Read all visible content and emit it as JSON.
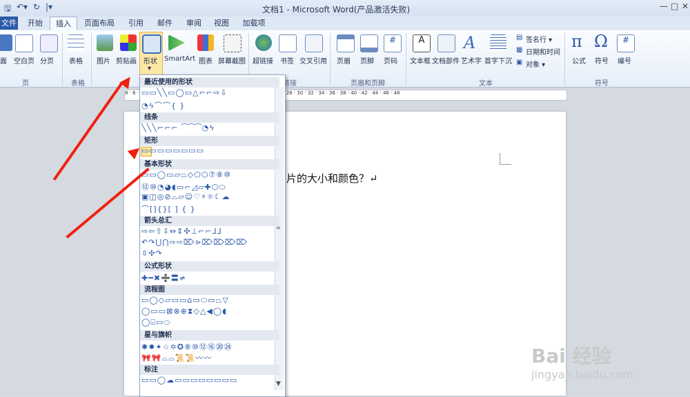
{
  "window": {
    "title": "文档1 - Microsoft Word(产品激活失败)",
    "controls": [
      "—",
      "□",
      "✕"
    ]
  },
  "tabs": [
    "文件",
    "开始",
    "插入",
    "页面布局",
    "引用",
    "邮件",
    "审阅",
    "视图",
    "加载项"
  ],
  "ribbon": {
    "buttons": {
      "cover": "面",
      "blank": "空白页",
      "break": "分页",
      "table": "表格",
      "picture": "图片",
      "clipart": "剪贴画",
      "shapes": "形状",
      "smartart": "SmartArt",
      "chart": "图表",
      "screenshot": "屏幕截图",
      "hyperlink": "超链接",
      "bookmark": "书签",
      "crossref": "交叉引用",
      "header": "页眉",
      "footer": "页脚",
      "pagenum": "页码",
      "textbox": "文本框",
      "quickparts": "文档部件",
      "wordart": "艺术字",
      "dropcap": "首字下沉",
      "signature": "签名行 ▾",
      "datetime": "日期和时间",
      "object": "对象 ▾",
      "equation": "公式",
      "symbol": "符号",
      "number": "编号"
    },
    "groups": {
      "pages": "页",
      "tables": "表格",
      "links": "链接",
      "headerfooter": "页眉和页脚",
      "text": "文本",
      "symbols": "符号"
    }
  },
  "ruler": "8 · 6 · 4 · 2 · · 2 · 4 · 6 · 8 · 10 · 12 · 14 · 16 · 18 · 20 · 22 · 24 · 26 · 28 · 30 · 32 · 34 · 36 · 38 · 40 · 42 · 44 · 46 · 48",
  "document": {
    "text": "片的大小和颜色？↵"
  },
  "shapes_menu": {
    "sections": {
      "recent": "最近使用的形状",
      "lines": "线条",
      "rect": "矩形",
      "basic": "基本形状",
      "arrows": "箭头总汇",
      "equation": "公式形状",
      "flowchart": "流程图",
      "stars": "星与旗帜",
      "callouts": "标注"
    },
    "rows": {
      "recent1": "▭▭╲╲▭◯▭△⌐⌐⇨⇩",
      "recent2": "◔ϟ⌒⌒{ }",
      "lines1": "╲╲╲⌐⌐⌐ ⁀⁀⁀◔ϟ",
      "rect1": "▭▭▭▭▭▭▭▭",
      "basic1": "▭▭◯▭▱⏢◇⬠⬡⑦⑧⑩",
      "basic2": "⑫⑩◔◕◖▭⌐◿▱✚⬡⬭",
      "basic3": "▣◫◎⊘⌓▱☺♡⚡☼☾☁",
      "basic4": "⌒[]{}[ ] { }",
      "arrows1": "⇨⇦⇧⇩⇔⇕✣⊥⌐⌐⅃⅃",
      "arrows2": "↶↷⋃⋂⇨⇨⌦⋗⌦⌦⌦⌦",
      "arrows3": "⇳✣↷",
      "eq1": "✚━✖➗〓≠",
      "flow1": "▭◯◇▱▭▭⌂▭⬭▭⏢▽",
      "flow2": "◯▭▭⊠⊗⊕⧗◇△◀◯◖",
      "flow3": "◯⌸▭⬭",
      "stars1": "✺✹✦☆✡✪⑧⑩⑫⑯⑳㉔",
      "stars2": "🎀🎀⌓⌓📜📜〰〰",
      "callout1": "▭▭◯☁▭▭▭▭▭▭▭▭"
    }
  },
  "watermark": {
    "brand": "Bai 经验",
    "url": "jingyan.baidu.com"
  }
}
